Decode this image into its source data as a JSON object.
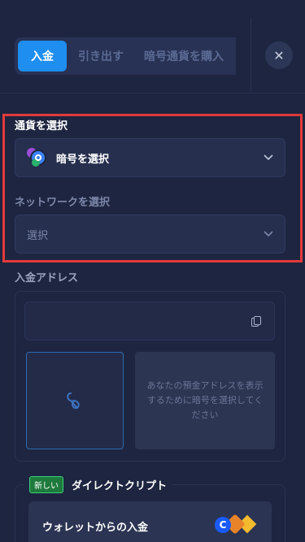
{
  "tabs": {
    "deposit": "入金",
    "withdraw": "引き出す",
    "buy_crypto": "暗号通貨を購入"
  },
  "currency": {
    "label": "通貨を選択",
    "value": "暗号を選択",
    "icon": "crypto-coins-icon"
  },
  "network": {
    "label": "ネットワークを選択",
    "placeholder": "選択"
  },
  "address": {
    "label": "入金アドレス",
    "value": "",
    "info": "あなたの預金アドレスを表示するために暗号を選択してください"
  },
  "direct_crypto": {
    "badge": "新しい",
    "title": "ダイレクトクリプト",
    "wallet_label": "ウォレットからの入金"
  },
  "colors": {
    "background": "#1e2540",
    "accent": "#1e8ef0",
    "highlight": "#e23a3a",
    "badge": "#1e7a3c"
  }
}
